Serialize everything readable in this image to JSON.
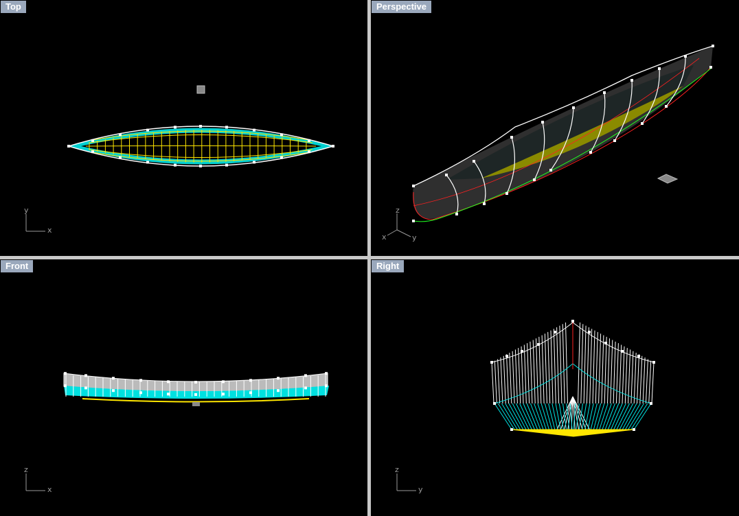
{
  "viewports": {
    "top": {
      "title": "Top",
      "axis_x": "x",
      "axis_y": "y"
    },
    "perspective": {
      "title": "Perspective",
      "axis_x": "x",
      "axis_y": "y",
      "axis_z": "z"
    },
    "front": {
      "title": "Front",
      "axis_x": "x",
      "axis_z": "z"
    },
    "right": {
      "title": "Right",
      "axis_y": "y",
      "axis_z": "z"
    }
  },
  "colors": {
    "viewport_bg": "#000000",
    "title_bg": "#9aa8bc",
    "title_text": "#ffffff",
    "wire_white": "#ffffff",
    "wire_cyan": "#00e5e5",
    "wire_yellow": "#ffe600",
    "wire_red": "#ff2020",
    "wire_green": "#20ff20",
    "hull_olive": "#8a8a00",
    "hull_grey": "#3a3a3a",
    "axis_grey": "#9a9a9a"
  },
  "icons": [
    "axis-triad-icon",
    "light-marker-icon"
  ]
}
